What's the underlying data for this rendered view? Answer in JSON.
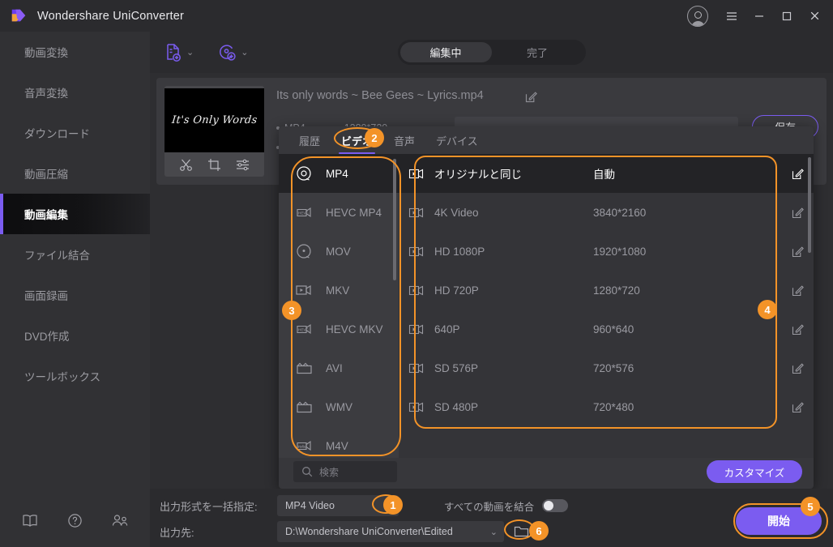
{
  "window": {
    "title": "Wondershare UniConverter",
    "controls": {
      "minimize": "–",
      "maximize": "□",
      "close": "✕",
      "menu": "≡"
    }
  },
  "sidebar": {
    "items": [
      {
        "label": "動画変換",
        "active": false
      },
      {
        "label": "音声変換",
        "active": false
      },
      {
        "label": "ダウンロード",
        "active": false
      },
      {
        "label": "動画圧縮",
        "active": false
      },
      {
        "label": "動画編集",
        "active": true
      },
      {
        "label": "ファイル結合",
        "active": false
      },
      {
        "label": "画面録画",
        "active": false
      },
      {
        "label": "DVD作成",
        "active": false
      },
      {
        "label": "ツールボックス",
        "active": false
      }
    ],
    "bottom_icons": [
      "book-icon",
      "help-icon",
      "users-icon"
    ]
  },
  "toolbar": {
    "add_file_icon": "add-file-icon",
    "add_disc_icon": "add-disc-icon",
    "chevron": "⌄",
    "segments": [
      {
        "label": "編集中",
        "active": true
      },
      {
        "label": "完了",
        "active": false
      }
    ]
  },
  "file_card": {
    "thumbnail_text": "It's Only Words",
    "filename": "Its only words ~ Bee Gees ~ Lyrics.mp4",
    "edit_icon": "edit-icon",
    "meta": {
      "format": "MP4",
      "resolution": "1280*720"
    },
    "tool_icons": [
      "scissors-icon",
      "crop-icon",
      "adjust-icon"
    ],
    "save_label": "保存"
  },
  "format_popup": {
    "tabs": [
      {
        "label": "履歴",
        "active": false
      },
      {
        "label": "ビデオ",
        "active": true
      },
      {
        "label": "音声",
        "active": false
      },
      {
        "label": "デバイス",
        "active": false
      }
    ],
    "formats": [
      {
        "label": "MP4",
        "icon": "disc-icon",
        "active": true
      },
      {
        "label": "HEVC MP4",
        "icon": "hevc-icon",
        "active": false
      },
      {
        "label": "MOV",
        "icon": "disc-dot-icon",
        "active": false
      },
      {
        "label": "MKV",
        "icon": "video-icon",
        "active": false
      },
      {
        "label": "HEVC MKV",
        "icon": "hevc-icon",
        "active": false
      },
      {
        "label": "AVI",
        "icon": "clapper-icon",
        "active": false
      },
      {
        "label": "WMV",
        "icon": "clapper-icon",
        "active": false
      },
      {
        "label": "M4V",
        "icon": "m4v-icon",
        "active": false
      }
    ],
    "resolutions": [
      {
        "name": "オリジナルと同じ",
        "size": "自動",
        "active": true
      },
      {
        "name": "4K Video",
        "size": "3840*2160",
        "active": false
      },
      {
        "name": "HD 1080P",
        "size": "1920*1080",
        "active": false
      },
      {
        "name": "HD 720P",
        "size": "1280*720",
        "active": false
      },
      {
        "name": "640P",
        "size": "960*640",
        "active": false
      },
      {
        "name": "SD 576P",
        "size": "720*576",
        "active": false
      },
      {
        "name": "SD 480P",
        "size": "720*480",
        "active": false
      }
    ],
    "search_placeholder": "検索",
    "customize_label": "カスタマイズ"
  },
  "bottom_bar": {
    "format_label": "出力形式を一括指定:",
    "format_value": "MP4 Video",
    "merge_label": "すべての動画を結合",
    "merge_on": false,
    "output_label": "出力先:",
    "output_value": "D:\\Wondershare UniConverter\\Edited",
    "folder_icon": "folder-icon",
    "start_label": "開始"
  },
  "annotations": {
    "badges": [
      "1",
      "2",
      "3",
      "4",
      "5",
      "6"
    ],
    "color": "#f39328"
  },
  "colors": {
    "accent_purple": "#7b5cf0",
    "annotation_orange": "#f39328",
    "bg_dark": "#2b2b2e",
    "panel": "#37373b"
  }
}
